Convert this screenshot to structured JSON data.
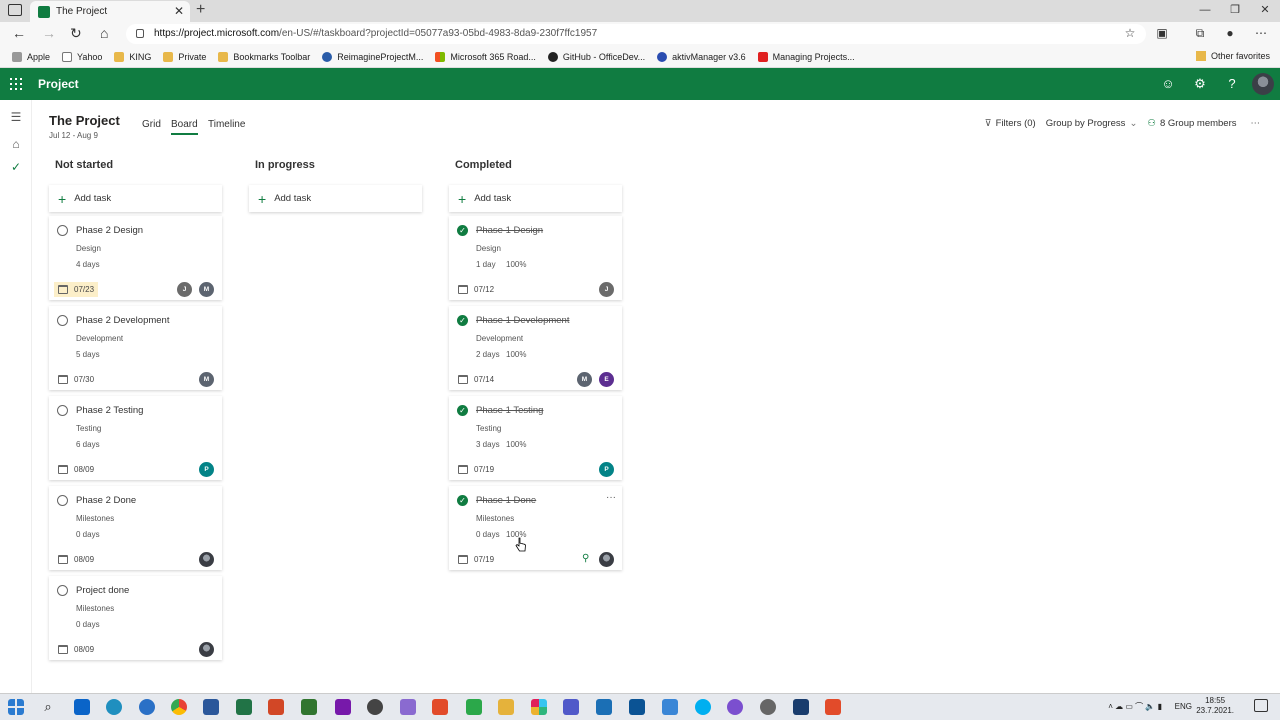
{
  "browser": {
    "tab_title": "The Project",
    "url_host": "https://project.microsoft.com",
    "url_path": "/en-US/#/taskboard?projectId=05077a93-05bd-4983-8da9-230f7ffc1957",
    "bookmarks": [
      "Apple",
      "Yahoo",
      "KING",
      "Private",
      "Bookmarks Toolbar",
      "ReimagineProjectM...",
      "Microsoft 365 Road...",
      "GitHub - OfficeDev...",
      "aktivManager v3.6",
      "Managing Projects..."
    ],
    "other_favorites": "Other favorites"
  },
  "app": {
    "name": "Project"
  },
  "project": {
    "title": "The Project",
    "dates": "Jul 12 - Aug 9",
    "views": [
      "Grid",
      "Board",
      "Timeline"
    ],
    "filters": "Filters (0)",
    "group_by": "Group by Progress",
    "members": "8 Group members"
  },
  "board": {
    "add_task": "Add task",
    "columns": [
      {
        "title": "Not started",
        "cards": [
          {
            "title": "Phase 2 Design",
            "bucket": "Design",
            "duration": "4 days",
            "date": "07/23",
            "late": true,
            "avatars": [
              {
                "letter": "J",
                "color": "#6b6b6b"
              },
              {
                "letter": "M",
                "color": "#5c6470"
              }
            ]
          },
          {
            "title": "Phase 2 Development",
            "bucket": "Development",
            "duration": "5 days",
            "date": "07/30",
            "avatars": [
              {
                "letter": "M",
                "color": "#5c6470"
              }
            ]
          },
          {
            "title": "Phase 2 Testing",
            "bucket": "Testing",
            "duration": "6 days",
            "date": "08/09",
            "avatars": [
              {
                "letter": "P",
                "color": "#038387"
              }
            ]
          },
          {
            "title": "Phase 2 Done",
            "bucket": "Milestones",
            "duration": "0 days",
            "date": "08/09",
            "avatars": [
              {
                "photo": true
              }
            ]
          },
          {
            "title": "Project done",
            "bucket": "Milestones",
            "duration": "0 days",
            "date": "08/09",
            "avatars": [
              {
                "photo": true
              }
            ]
          }
        ]
      },
      {
        "title": "In progress",
        "cards": []
      },
      {
        "title": "Completed",
        "cards": [
          {
            "title": "Phase 1 Design",
            "bucket": "Design",
            "duration": "1 day",
            "percent": "100%",
            "date": "07/12",
            "avatars": [
              {
                "letter": "J",
                "color": "#6b6b6b"
              }
            ]
          },
          {
            "title": "Phase 1 Development",
            "bucket": "Development",
            "duration": "2 days",
            "percent": "100%",
            "date": "07/14",
            "avatars": [
              {
                "letter": "M",
                "color": "#5c6470"
              },
              {
                "letter": "E",
                "color": "#5c2e91"
              }
            ]
          },
          {
            "title": "Phase 1 Testing",
            "bucket": "Testing",
            "duration": "3 days",
            "percent": "100%",
            "date": "07/19",
            "avatars": [
              {
                "letter": "P",
                "color": "#038387"
              }
            ]
          },
          {
            "title": "Phase 1 Done",
            "bucket": "Milestones",
            "duration": "0 days",
            "percent": "100%",
            "date": "07/19",
            "more": "···",
            "assign_icon": true,
            "avatars": [
              {
                "photo": true
              }
            ]
          }
        ]
      }
    ]
  },
  "taskbar": {
    "lang": "ENG",
    "time": "18:55",
    "date": "23.7.2021."
  }
}
